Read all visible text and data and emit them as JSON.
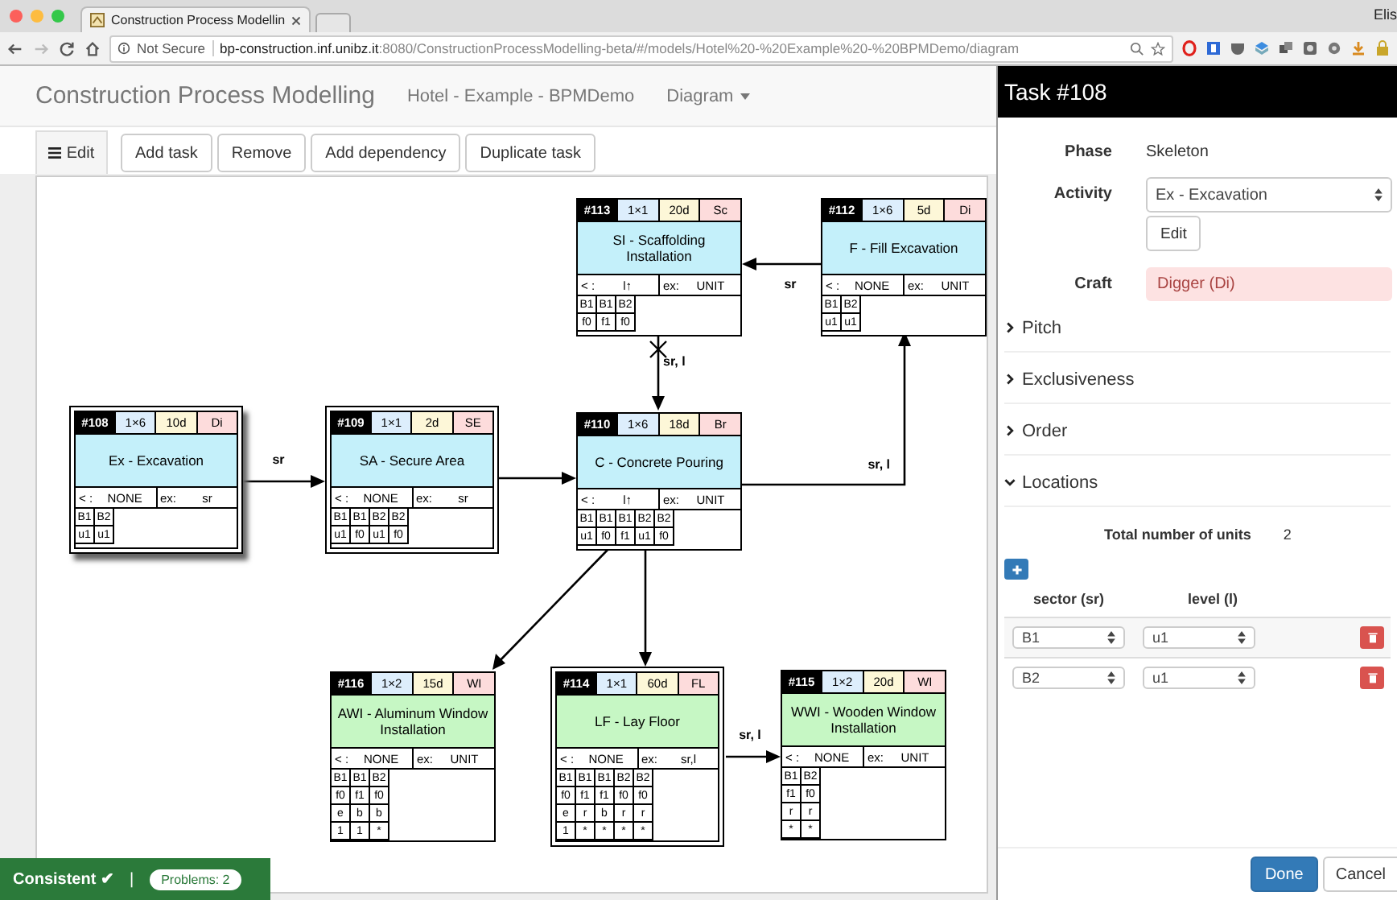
{
  "browser": {
    "tab_title": "Construction Process Modellin",
    "user": "Elis",
    "security": "Not Secure",
    "url_host": "bp-construction.inf.unibz.it",
    "url_rest": ":8080/ConstructionProcessModelling-beta/#/models/Hotel%20-%20Example%20-%20BPMDemo/diagram"
  },
  "navbar": {
    "brand": "Construction Process Modelling",
    "model": "Hotel - Example - BPMDemo",
    "menu": "Diagram"
  },
  "toolbar": {
    "mode": "Edit",
    "buttons": [
      "Add task",
      "Remove",
      "Add dependency",
      "Duplicate task"
    ]
  },
  "nodes": [
    {
      "id": "#113",
      "count": "1×1",
      "duration": "20d",
      "craft": "Sc",
      "name": "SI - Scaffolding Installation",
      "color": "#c4f0fa",
      "outlined": false,
      "selected": false,
      "order_label": "< :",
      "order": "l↑",
      "ex_label": "ex:",
      "exclusive": "UNIT",
      "locations": [
        [
          "B1",
          "B1",
          "B2"
        ],
        [
          "f0",
          "f1",
          "f0"
        ]
      ]
    },
    {
      "id": "#112",
      "count": "1×6",
      "duration": "5d",
      "craft": "Di",
      "name": "F - Fill Excavation",
      "color": "#c4f0fa",
      "outlined": false,
      "selected": false,
      "order_label": "< :",
      "order": "NONE",
      "ex_label": "ex:",
      "exclusive": "UNIT",
      "locations": [
        [
          "B1",
          "B2"
        ],
        [
          "u1",
          "u1"
        ]
      ]
    },
    {
      "id": "#108",
      "count": "1×6",
      "duration": "10d",
      "craft": "Di",
      "name": "Ex - Excavation",
      "color": "#c4f0fa",
      "outlined": true,
      "selected": true,
      "order_label": "< :",
      "order": "NONE",
      "ex_label": "ex:",
      "exclusive": "sr",
      "locations": [
        [
          "B1",
          "B2"
        ],
        [
          "u1",
          "u1"
        ]
      ]
    },
    {
      "id": "#109",
      "count": "1×1",
      "duration": "2d",
      "craft": "SE",
      "name": "SA - Secure Area",
      "color": "#c4f0fa",
      "outlined": true,
      "selected": false,
      "order_label": "< :",
      "order": "NONE",
      "ex_label": "ex:",
      "exclusive": "sr",
      "locations": [
        [
          "B1",
          "B1",
          "B2",
          "B2"
        ],
        [
          "u1",
          "f0",
          "u1",
          "f0"
        ]
      ]
    },
    {
      "id": "#110",
      "count": "1×6",
      "duration": "18d",
      "craft": "Br",
      "name": "C - Concrete Pouring",
      "color": "#c4f0fa",
      "outlined": false,
      "selected": false,
      "order_label": "< :",
      "order": "l↑",
      "ex_label": "ex:",
      "exclusive": "UNIT",
      "locations": [
        [
          "B1",
          "B1",
          "B1",
          "B2",
          "B2"
        ],
        [
          "u1",
          "f0",
          "f1",
          "u1",
          "f0"
        ]
      ]
    },
    {
      "id": "#116",
      "count": "1×2",
      "duration": "15d",
      "craft": "WI",
      "name": "AWI - Aluminum Window Installation",
      "color": "#c6f7c4",
      "outlined": false,
      "selected": false,
      "order_label": "< :",
      "order": "NONE",
      "ex_label": "ex:",
      "exclusive": "UNIT",
      "locations": [
        [
          "B1",
          "B1",
          "B2"
        ],
        [
          "f0",
          "f1",
          "f0"
        ],
        [
          "e",
          "b",
          "b"
        ],
        [
          "1",
          "1",
          "*"
        ]
      ]
    },
    {
      "id": "#114",
      "count": "1×1",
      "duration": "60d",
      "craft": "FL",
      "name": "LF - Lay Floor",
      "color": "#c6f7c4",
      "outlined": true,
      "selected": false,
      "order_label": "< :",
      "order": "NONE",
      "ex_label": "ex:",
      "exclusive": "sr,l",
      "locations": [
        [
          "B1",
          "B1",
          "B1",
          "B2",
          "B2"
        ],
        [
          "f0",
          "f1",
          "f1",
          "f0",
          "f0"
        ],
        [
          "e",
          "r",
          "b",
          "r",
          "r"
        ],
        [
          "1",
          "*",
          "*",
          "*",
          "*"
        ]
      ]
    },
    {
      "id": "#115",
      "count": "1×2",
      "duration": "20d",
      "craft": "WI",
      "name": "WWI - Wooden Window Installation",
      "color": "#c6f7c4",
      "outlined": false,
      "selected": false,
      "order_label": "< :",
      "order": "NONE",
      "ex_label": "ex:",
      "exclusive": "UNIT",
      "locations": [
        [
          "B1",
          "B2"
        ],
        [
          "f1",
          "f0"
        ],
        [
          "r",
          "r"
        ],
        [
          "*",
          "*"
        ]
      ]
    }
  ],
  "edges": [
    {
      "label": "sr",
      "crossed": false
    },
    {
      "label": "sr",
      "crossed": false
    },
    {
      "label": "sr, l",
      "crossed": true
    },
    {
      "label": "sr, l",
      "crossed": false
    },
    {
      "label": "sr, l",
      "crossed": false
    }
  ],
  "status": {
    "state": "Consistent ✔",
    "separator": "|",
    "problems": "Problems: 2"
  },
  "panel": {
    "title": "Task #108",
    "fields": [
      {
        "label": "Phase",
        "kind": "text",
        "value": "Skeleton"
      },
      {
        "label": "Activity",
        "kind": "select",
        "value": "Ex - Excavation",
        "button": "Edit"
      },
      {
        "label": "Craft",
        "kind": "craft",
        "value": "Digger (Di)"
      }
    ],
    "sections": [
      {
        "title": "Pitch",
        "expanded": false
      },
      {
        "title": "Exclusiveness",
        "expanded": false
      },
      {
        "title": "Order",
        "expanded": false
      },
      {
        "title": "Locations",
        "expanded": true,
        "units_label": "Total number of units",
        "units": "2",
        "columns": [
          "sector (sr)",
          "level (l)"
        ],
        "rows": [
          {
            "sector": "B1",
            "level": "u1"
          },
          {
            "sector": "B2",
            "level": "u1"
          }
        ]
      }
    ],
    "done": "Done",
    "cancel": "Cancel"
  }
}
